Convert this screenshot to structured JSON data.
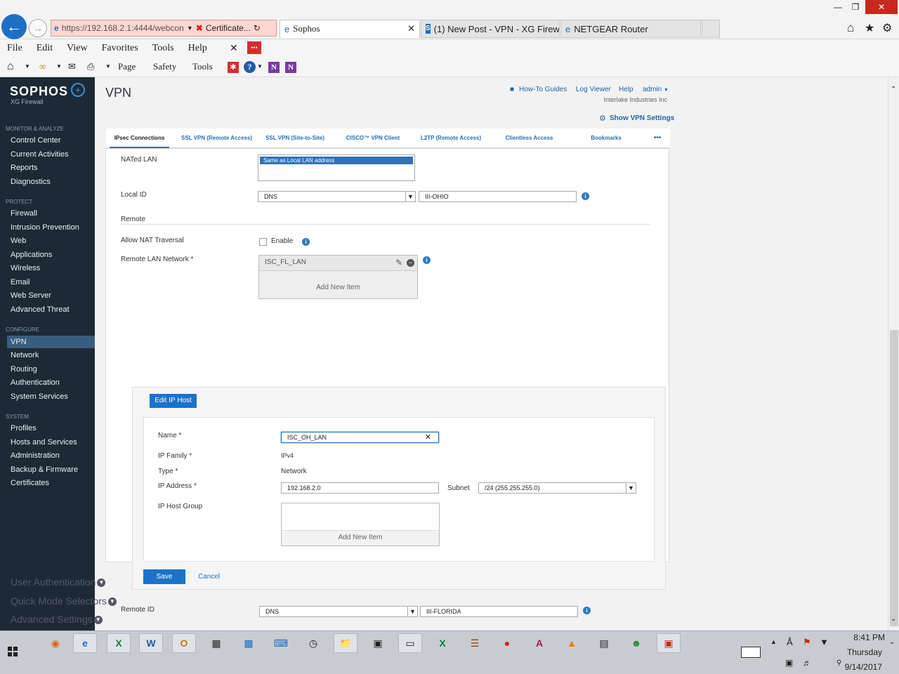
{
  "browser": {
    "address": "https://192.168.2.1:4444/webcon",
    "cert_error": "Certificate...",
    "tabs": [
      {
        "label": "Sophos"
      },
      {
        "label": "(1) New Post - VPN - XG Firew..."
      },
      {
        "label": "NETGEAR Router"
      }
    ],
    "menu": [
      "File",
      "Edit",
      "View",
      "Favorites",
      "Tools",
      "Help"
    ],
    "commands": [
      "Page",
      "Safety",
      "Tools"
    ]
  },
  "sidebar": {
    "brand": "SOPHOS",
    "product": "XG Firewall",
    "sections": [
      {
        "title": "MONITOR & ANALYZE",
        "items": [
          "Control Center",
          "Current Activities",
          "Reports",
          "Diagnostics"
        ]
      },
      {
        "title": "PROTECT",
        "items": [
          "Firewall",
          "Intrusion Prevention",
          "Web",
          "Applications",
          "Wireless",
          "Email",
          "Web Server",
          "Advanced Threat"
        ]
      },
      {
        "title": "CONFIGURE",
        "items": [
          "VPN",
          "Network",
          "Routing",
          "Authentication",
          "System Services"
        ]
      },
      {
        "title": "SYSTEM",
        "items": [
          "Profiles",
          "Hosts and Services",
          "Administration",
          "Backup & Firmware",
          "Certificates"
        ]
      }
    ],
    "active": "VPN"
  },
  "header": {
    "title": "VPN",
    "links": [
      "How-To Guides",
      "Log Viewer",
      "Help",
      "admin"
    ],
    "org": "Interlake Industries Inc",
    "show_settings": "Show VPN Settings"
  },
  "tabs": [
    "IPsec Connections",
    "SSL VPN (Remote Access)",
    "SSL VPN (Site-to-Site)",
    "CISCO™ VPN Client",
    "L2TP (Remote Access)",
    "Clientless Access",
    "Bookmarks",
    "•••"
  ],
  "form": {
    "nated_lan_label": "NATed LAN",
    "nated_lan_value": "Same as Local LAN address",
    "local_id_label": "Local ID",
    "local_id_type": "DNS",
    "local_id_value": "III-OHIO",
    "remote_heading": "Remote",
    "nat_traversal_label": "Allow NAT Traversal",
    "nat_traversal_check": "Enable",
    "remote_lan_label": "Remote LAN Network *",
    "remote_lan_item": "ISC_FL_LAN",
    "add_new_item": "Add New Item",
    "remote_id_label": "Remote ID",
    "remote_id_type": "DNS",
    "remote_id_value": "III-FLORIDA"
  },
  "dialog": {
    "title": "Edit IP Host",
    "name_label": "Name *",
    "name_value": "ISC_OH_LAN",
    "family_label": "IP Family *",
    "family_value": "IPv4",
    "type_label": "Type *",
    "type_value": "Network",
    "ip_label": "IP Address *",
    "ip_value": "192.168.2.0",
    "subnet_label": "Subnet",
    "subnet_value": "/24 (255.255.255.0)",
    "group_label": "IP Host Group",
    "group_add": "Add New Item",
    "save": "Save",
    "cancel": "Cancel"
  },
  "accordions": [
    "User Authentication",
    "Quick Mode Selectors",
    "Advanced Settings"
  ],
  "taskbar": {
    "time": "8:41 PM",
    "day": "Thursday",
    "date": "9/14/2017"
  },
  "colors": {
    "accent": "#1a73c9",
    "sidebar": "#1d2a36"
  }
}
